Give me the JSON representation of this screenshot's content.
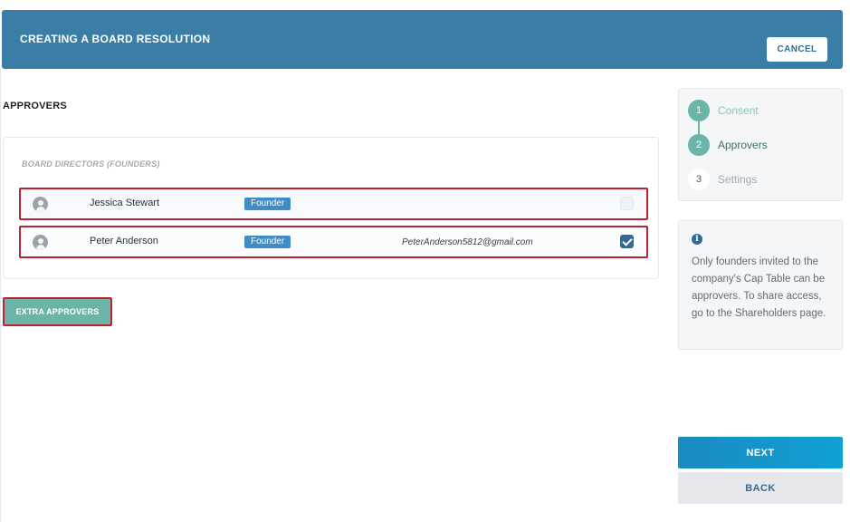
{
  "header": {
    "title": "CREATING A BOARD RESOLUTION",
    "cancel_label": "CANCEL"
  },
  "section": {
    "title": "APPROVERS",
    "group_label": "BOARD DIRECTORS (FOUNDERS)"
  },
  "approvers": [
    {
      "name": "Jessica Stewart",
      "role": "Founder",
      "email": "",
      "selected": false
    },
    {
      "name": "Peter Anderson",
      "role": "Founder",
      "email": "PeterAnderson5812@gmail.com",
      "selected": true
    }
  ],
  "extra_approvers_label": "EXTRA APPROVERS",
  "steps": [
    {
      "number": "1",
      "label": "Consent",
      "state": "done"
    },
    {
      "number": "2",
      "label": "Approvers",
      "state": "active"
    },
    {
      "number": "3",
      "label": "Settings",
      "state": "pending"
    }
  ],
  "info": {
    "icon": "info-icon",
    "icon_glyph": "i",
    "text": "Only founders invited to the company's Cap Table can be approvers. To share access, go to the Shareholders page."
  },
  "actions": {
    "next_label": "NEXT",
    "back_label": "BACK"
  },
  "colors": {
    "header": "#3a7ea8",
    "accent_green": "#6bb5a8",
    "badge_blue": "#3f8cc6",
    "highlight_red": "#b8242f",
    "primary_button": "#1b8ac2"
  }
}
